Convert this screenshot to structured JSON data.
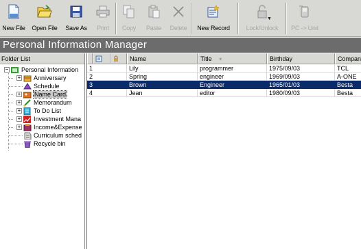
{
  "toolbar": {
    "buttons": [
      {
        "label": "New File",
        "icon": "new-file-icon",
        "enabled": true
      },
      {
        "label": "Open File",
        "icon": "open-file-icon",
        "enabled": true
      },
      {
        "label": "Save As",
        "icon": "save-icon",
        "enabled": true
      },
      {
        "label": "Print",
        "icon": "printer-icon",
        "enabled": false
      },
      {
        "label": "Copy",
        "icon": "copy-icon",
        "enabled": false
      },
      {
        "label": "Paste",
        "icon": "paste-icon",
        "enabled": false
      },
      {
        "label": "Delete",
        "icon": "delete-x-icon",
        "enabled": false
      },
      {
        "label": "New Record",
        "icon": "new-record-icon",
        "enabled": true
      },
      {
        "label": "Lock/Unlock",
        "icon": "lock-icon",
        "enabled": false
      },
      {
        "label": "PC -> Unit",
        "icon": "transfer-icon",
        "enabled": false
      }
    ]
  },
  "app": {
    "title": "Personal Information Manager"
  },
  "folder_list": {
    "header": "Folder List",
    "root": "Personal Information",
    "items": [
      {
        "label": "Anniversary",
        "icon": "anniversary-icon",
        "expandable": true
      },
      {
        "label": "Schedule",
        "icon": "schedule-icon",
        "expandable": false
      },
      {
        "label": "Name Card",
        "icon": "name-card-icon",
        "expandable": true,
        "selected": true
      },
      {
        "label": "Memorandum",
        "icon": "memorandum-icon",
        "expandable": true
      },
      {
        "label": "To Do List",
        "icon": "todo-icon",
        "expandable": true
      },
      {
        "label": "Investment Mana",
        "icon": "investment-icon",
        "expandable": true
      },
      {
        "label": "Income&Expense",
        "icon": "income-expense-icon",
        "expandable": true
      },
      {
        "label": "Curriculum sched",
        "icon": "curriculum-icon",
        "expandable": false
      },
      {
        "label": "Recycle bin",
        "icon": "recycle-bin-icon",
        "expandable": false
      }
    ]
  },
  "grid": {
    "columns": [
      "",
      "",
      "",
      "Name",
      "Title",
      "Birthday",
      "Compan"
    ],
    "rows": [
      {
        "num": "1",
        "name": "Lily",
        "title": "programmer",
        "birthday": "1975/09/03",
        "company": "TCL"
      },
      {
        "num": "2",
        "name": "Spring",
        "title": "engineer",
        "birthday": "1969/09/03",
        "company": "A-ONE"
      },
      {
        "num": "3",
        "name": "Brown",
        "title": "Engineer",
        "birthday": "1965/01/03",
        "company": "Besta",
        "selected": true
      },
      {
        "num": "4",
        "name": "Jean",
        "title": "editor",
        "birthday": "1980/09/03",
        "company": "Besta"
      }
    ]
  },
  "colors": {
    "selection": "#0a2a6a",
    "banner": "#6c6c6c",
    "toolbar": "#d8d8d4"
  }
}
